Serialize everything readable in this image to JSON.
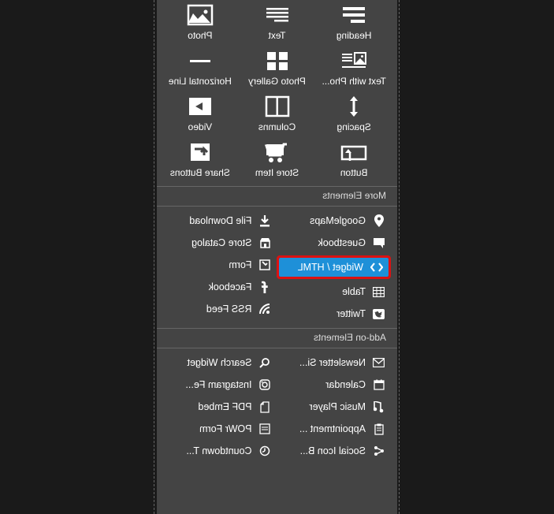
{
  "mirrored": true,
  "primary_tiles": [
    {
      "name": "heading",
      "label": "Heading"
    },
    {
      "name": "text",
      "label": "Text"
    },
    {
      "name": "photo",
      "label": "Photo"
    },
    {
      "name": "textwithphoto",
      "label": "Text with Pho..."
    },
    {
      "name": "photogallery",
      "label": "Photo Gallery"
    },
    {
      "name": "horizontalline",
      "label": "Horizontal Line"
    },
    {
      "name": "spacing",
      "label": "Spacing"
    },
    {
      "name": "columns",
      "label": "Columns"
    },
    {
      "name": "video",
      "label": "Video"
    },
    {
      "name": "button",
      "label": "Button"
    },
    {
      "name": "storeitem",
      "label": "Store Item"
    },
    {
      "name": "sharebuttons",
      "label": "Share Buttons"
    }
  ],
  "sections": {
    "more": {
      "title": "More Elements",
      "left": [
        {
          "name": "googlemaps",
          "label": "GoogleMaps"
        },
        {
          "name": "guestbook",
          "label": "Guestbook"
        },
        {
          "name": "widgethtml",
          "label": "Widget / HTML",
          "highlighted": true
        },
        {
          "name": "table",
          "label": "Table"
        },
        {
          "name": "twitter",
          "label": "Twitter"
        }
      ],
      "right": [
        {
          "name": "filedownload",
          "label": "File Download"
        },
        {
          "name": "storecatalog",
          "label": "Store Catalog"
        },
        {
          "name": "form",
          "label": "Form"
        },
        {
          "name": "facebook",
          "label": "Facebook"
        },
        {
          "name": "rssfeed",
          "label": "RSS Feed"
        }
      ]
    },
    "addon": {
      "title": "Add-on Elements",
      "left": [
        {
          "name": "newsletter",
          "label": "Newsletter Si..."
        },
        {
          "name": "calendar",
          "label": "Calendar"
        },
        {
          "name": "musicplayer",
          "label": "Music Player"
        },
        {
          "name": "appointment",
          "label": "Appointment ..."
        },
        {
          "name": "socialiconbar",
          "label": "Social Icon B..."
        }
      ],
      "right": [
        {
          "name": "searchwidget",
          "label": "Search Widget"
        },
        {
          "name": "instagramfeed",
          "label": "Instagram Fe..."
        },
        {
          "name": "pdfembed",
          "label": "PDF Embed"
        },
        {
          "name": "powrform",
          "label": "POWr Form"
        },
        {
          "name": "countdowntimer",
          "label": "Countdown T..."
        }
      ]
    }
  }
}
